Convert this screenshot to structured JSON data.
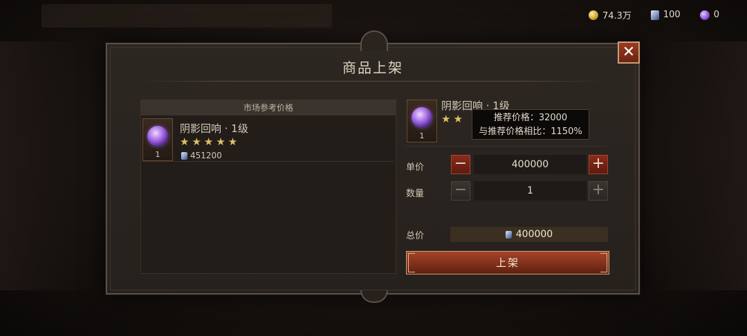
{
  "resources": [
    {
      "icon": "gold-coin-icon",
      "value": "74.3万"
    },
    {
      "icon": "platinum-icon",
      "value": "100"
    },
    {
      "icon": "orb-icon",
      "value": "0"
    }
  ],
  "dialog": {
    "title": "商品上架",
    "close_label": "✕"
  },
  "market": {
    "header": "市场参考价格",
    "entry": {
      "name": "阴影回响 · 1级",
      "stars": "★★★★★",
      "quantity": "1",
      "price": "451200"
    }
  },
  "item": {
    "name": "阴影回响 · 1级",
    "stars": "★★",
    "quantity": "1"
  },
  "tooltip": {
    "line1": "推荐价格：32000",
    "line2": "与推荐价格相比：1150%"
  },
  "unit_price": {
    "label": "单价",
    "value": "400000",
    "minus": "−",
    "plus": "+"
  },
  "quantity": {
    "label": "数量",
    "value": "1",
    "minus": "−",
    "plus": "+"
  },
  "total": {
    "label": "总价",
    "value": "400000"
  },
  "submit_label": "上架",
  "colors": {
    "accent": "#9a3a22",
    "star": "#e0c064",
    "panel": "#2d2722"
  }
}
